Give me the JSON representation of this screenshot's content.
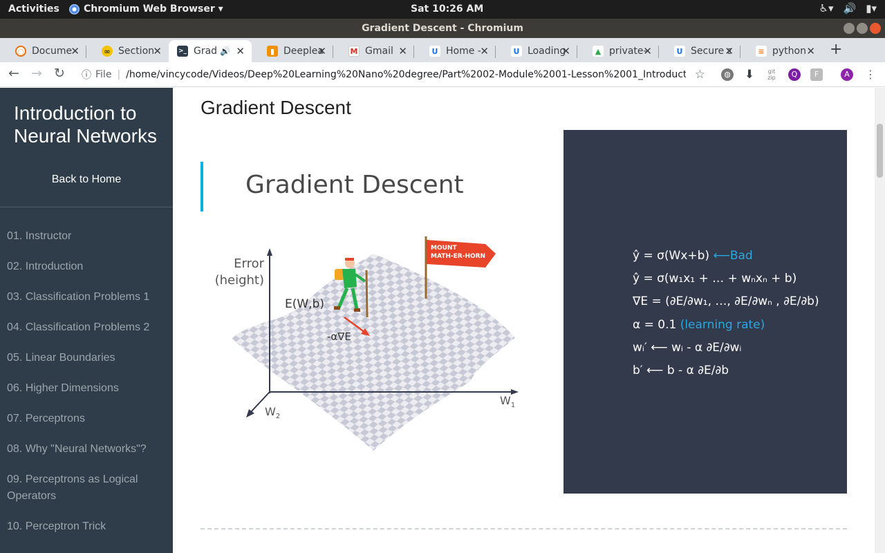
{
  "system_bar": {
    "activities": "Activities",
    "app_name": "Chromium Web Browser ▾",
    "clock": "Sat 10:26 AM"
  },
  "window": {
    "title": "Gradient Descent - Chromium"
  },
  "tabs": [
    {
      "label": "Docume",
      "favicon_color": "#e8710a",
      "favicon": "◌"
    },
    {
      "label": "Section",
      "favicon_color": "#f5c400",
      "favicon": "∞"
    },
    {
      "label": "Grad",
      "favicon_color": "#2e3d49",
      "favicon": ">_"
    },
    {
      "label": "Deeplea",
      "favicon_color": "#f29100",
      "favicon": "▮"
    },
    {
      "label": "Gmail",
      "favicon_color": "#d93025",
      "favicon": "M"
    },
    {
      "label": "Home - ",
      "favicon_color": "#1a73e8",
      "favicon": "U"
    },
    {
      "label": "Loading",
      "favicon_color": "#1a73e8",
      "favicon": "U"
    },
    {
      "label": "private-",
      "favicon_color": "#34a853",
      "favicon": "▲"
    },
    {
      "label": "Secure a",
      "favicon_color": "#1a73e8",
      "favicon": "U"
    },
    {
      "label": "python",
      "favicon_color": "#f48024",
      "favicon": "≡"
    }
  ],
  "address_bar": {
    "scheme": "File",
    "url": "/home/vincycode/Videos/Deep%20Learning%20Nano%20degree/Part%2002-Module%2001-Lesson%2001_Introduction%20..."
  },
  "sidebar": {
    "course_title": "Introduction to Neural Networks",
    "back_link": "Back to Home",
    "lessons": [
      "01. Instructor",
      "02. Introduction",
      "03. Classification Problems 1",
      "04. Classification Problems 2",
      "05. Linear Boundaries",
      "06. Higher Dimensions",
      "07. Perceptrons",
      "08. Why \"Neural Networks\"?",
      "09. Perceptrons as Logical Operators",
      "10. Perceptron Trick"
    ]
  },
  "content": {
    "page_title": "Gradient Descent",
    "slide": {
      "title": "Gradient Descent",
      "axis_error": "Error",
      "axis_height": "(height)",
      "point_label": "E(W,b)",
      "gradient_label": "-α∇E",
      "flag_line1": "MOUNT",
      "flag_line2": "MATH-ER-HORN",
      "w1": "W",
      "w1_sub": "1",
      "w2": "W",
      "w2_sub": "2"
    },
    "equations": {
      "line1": "ŷ = σ(Wx+b)",
      "line1_note": "⟵Bad",
      "line2": "ŷ = σ(w₁x₁ + … + wₙxₙ + b)",
      "line3": "∇E = (∂E/∂w₁, …, ∂E/∂wₙ , ∂E/∂b)",
      "line4": "α =  0.1",
      "line4_note": "(learning rate)",
      "line5": "wᵢ′ ⟵ wᵢ - α  ∂E/∂wᵢ",
      "line6": "b′ ⟵ b - α  ∂E/∂b"
    }
  }
}
